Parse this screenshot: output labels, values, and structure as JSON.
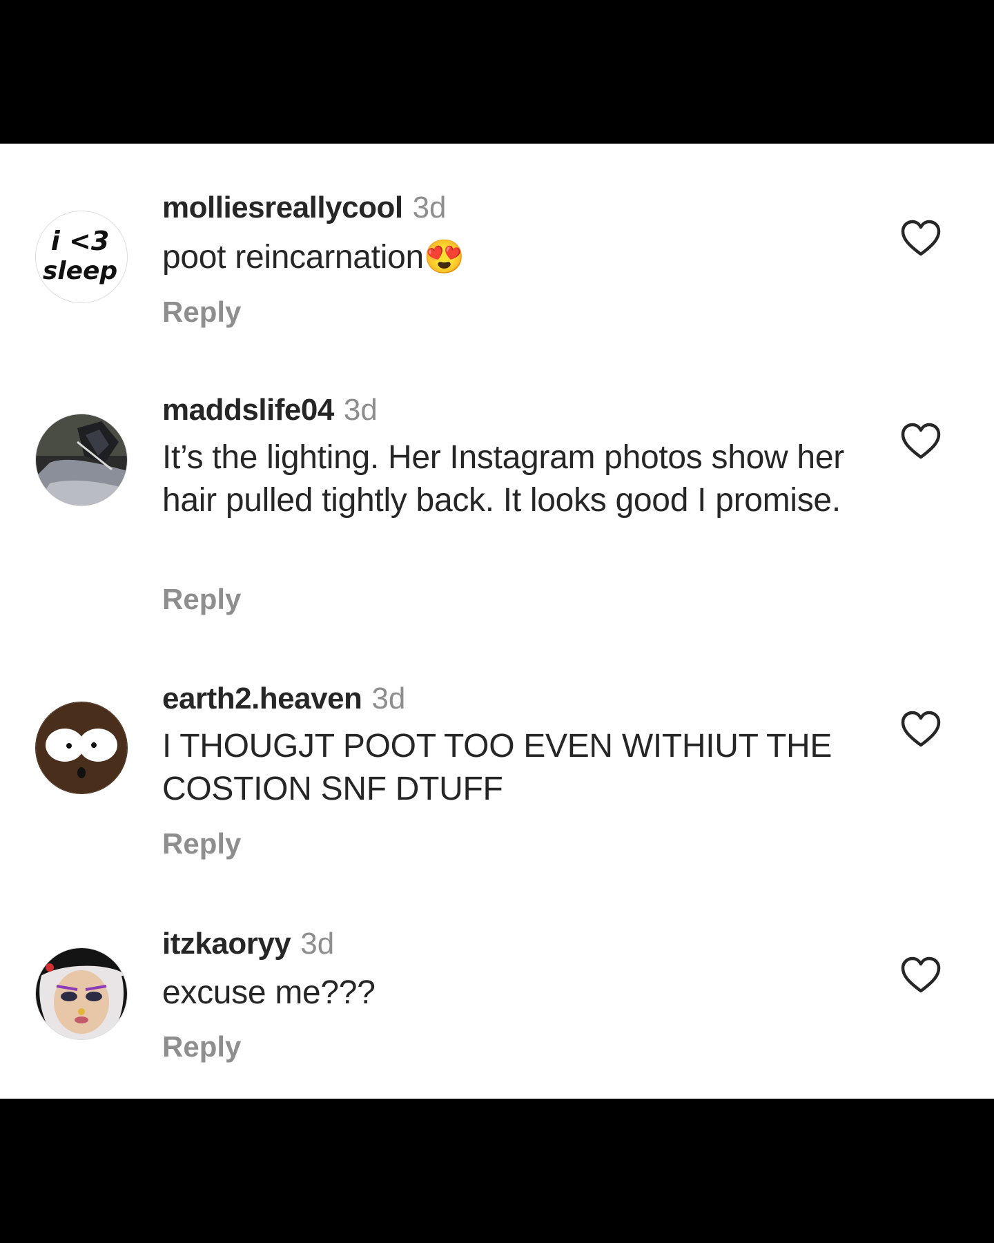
{
  "comments": [
    {
      "username": "molliesreallycool",
      "time": "3d",
      "text": "poot reincarnation😍",
      "reply": "Reply",
      "avatar": {
        "type": "text-logo",
        "text": "i <3 sleep"
      },
      "like_icon": "heart-outline-icon"
    },
    {
      "username": "maddslife04",
      "time": "3d",
      "text": "It’s the lighting. Her Instagram photos show her hair pulled tightly back. It looks good I promise.",
      "reply": "Reply",
      "avatar": {
        "type": "photo"
      },
      "like_icon": "heart-outline-icon"
    },
    {
      "username": "earth2.heaven",
      "time": "3d",
      "text": "I THOUGJT POOT TOO EVEN WITHIUT THE COSTION SNF DTUFF",
      "reply": "Reply",
      "avatar": {
        "type": "cartoon-face"
      },
      "like_icon": "heart-outline-icon"
    },
    {
      "username": "itzkaoryy",
      "time": "3d",
      "text": "excuse me???",
      "reply": "Reply",
      "avatar": {
        "type": "photo"
      },
      "like_icon": "heart-outline-icon"
    }
  ],
  "colors": {
    "text": "#262626",
    "secondary": "#8e8e8e",
    "background": "#ffffff",
    "frame": "#000000"
  }
}
